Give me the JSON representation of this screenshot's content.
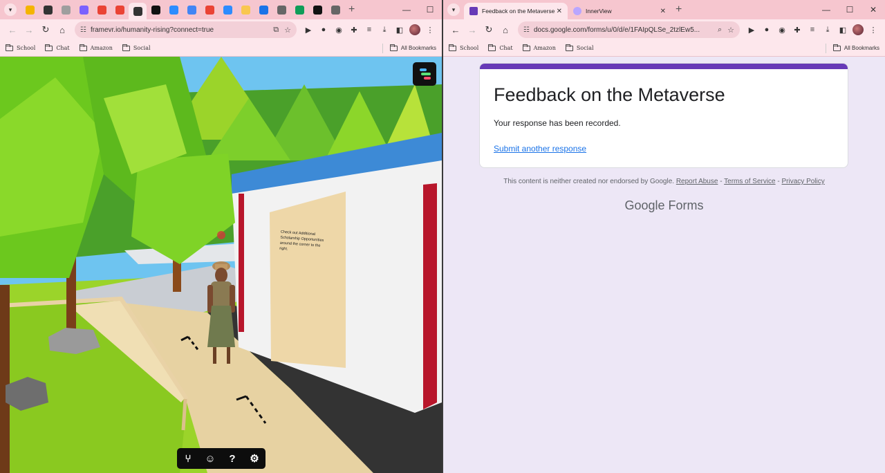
{
  "left_window": {
    "url": "framevr.io/humanity-rising?connect=true",
    "bookmarks": [
      "School",
      "Chat",
      "Amazon",
      "Social"
    ],
    "all_bookmarks": "All Bookmarks",
    "sign_text": "Check out Additional Scholarship Opportunities around the corner to the right.",
    "pinned_tabs": [
      {
        "icon": "classroom-icon",
        "color": "#f4b400"
      },
      {
        "icon": "contacts-icon",
        "color": "#333333"
      },
      {
        "icon": "chrome-icon",
        "color": "#9e9e9e"
      },
      {
        "icon": "innerview-icon",
        "color": "#7b61ff"
      },
      {
        "icon": "gmail-icon",
        "color": "#ea4335"
      },
      {
        "icon": "gmail-icon",
        "color": "#ea4335"
      },
      {
        "icon": "close-icon",
        "color": "#333333"
      },
      {
        "icon": "analytics-icon",
        "color": "#111111"
      },
      {
        "icon": "zoom-icon",
        "color": "#2d8cff"
      },
      {
        "icon": "google-icon",
        "color": "#4285f4"
      },
      {
        "icon": "gmail-icon",
        "color": "#ea4335"
      },
      {
        "icon": "zoom-icon",
        "color": "#2d8cff"
      },
      {
        "icon": "sheet-icon",
        "color": "#f9c74f"
      },
      {
        "icon": "calendar-icon",
        "color": "#1a73e8"
      },
      {
        "icon": "chrome-icon",
        "color": "#666666"
      },
      {
        "icon": "classroom-icon",
        "color": "#0f9d58"
      },
      {
        "icon": "s-icon",
        "color": "#111111"
      },
      {
        "icon": "chrome-icon",
        "color": "#666666"
      }
    ]
  },
  "right_window": {
    "tabs": [
      {
        "title": "Feedback on the Metaverse",
        "active": true
      },
      {
        "title": "InnerView",
        "active": false
      }
    ],
    "url": "docs.google.com/forms/u/0/d/e/1FAIpQLSe_2tzlEw5...",
    "bookmarks": [
      "School",
      "Chat",
      "Amazon",
      "Social"
    ],
    "all_bookmarks": "All Bookmarks",
    "form": {
      "title": "Feedback on the Metaverse",
      "message": "Your response has been recorded.",
      "link": "Submit another response",
      "disclaimer": "This content is neither created nor endorsed by Google.",
      "report": "Report Abuse",
      "terms": "Terms of Service",
      "privacy": "Privacy Policy",
      "brand_google": "Google",
      "brand_forms": "Forms",
      "accent": "#673ab7"
    }
  }
}
